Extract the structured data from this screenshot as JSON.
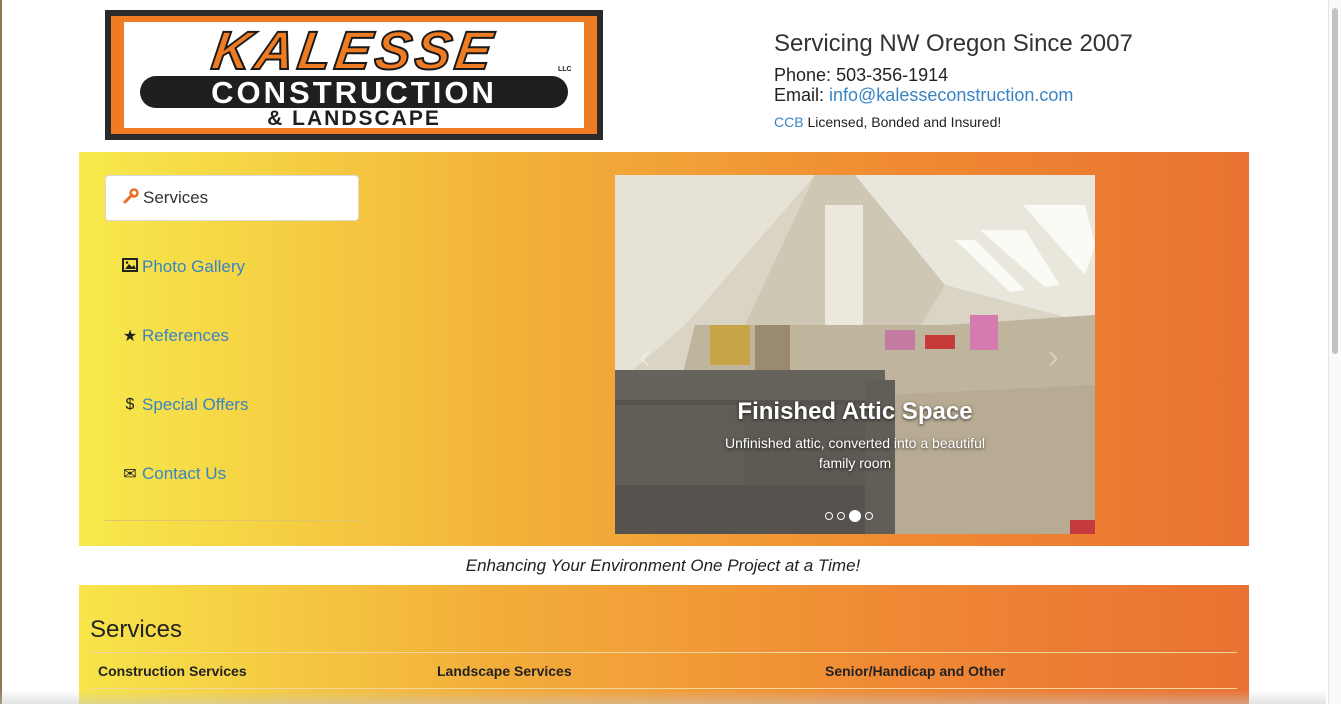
{
  "logo": {
    "brand": "KALESSE",
    "llc": "LLC",
    "line2": "CONSTRUCTION",
    "line3": "& LANDSCAPE"
  },
  "header": {
    "tagline": "Servicing NW Oregon Since 2007",
    "phone_label": "Phone: ",
    "phone": "503-356-1914",
    "email_label": "Email: ",
    "email": "info@kalesseconstruction.com",
    "ccb_link": "CCB",
    "ccb_text": " Licensed, Bonded and Insured!"
  },
  "nav": {
    "items": [
      {
        "label": "Services",
        "icon": "wrench-icon",
        "glyph": "🔧"
      },
      {
        "label": "Photo Gallery",
        "icon": "picture-icon",
        "glyph": "▣"
      },
      {
        "label": "References",
        "icon": "star-icon",
        "glyph": "★"
      },
      {
        "label": "Special Offers",
        "icon": "dollar-icon",
        "glyph": "$"
      },
      {
        "label": "Contact Us",
        "icon": "envelope-icon",
        "glyph": "✉"
      }
    ]
  },
  "carousel": {
    "caption_title": "Finished Attic Space",
    "caption_text": "Unfinished attic, converted into a beautiful family room",
    "prev_glyph": "‹",
    "next_glyph": "›",
    "slide_count": 4,
    "active_index": 2
  },
  "motto": "Enhancing Your Environment One Project at a Time!",
  "services": {
    "heading": "Services",
    "columns": [
      "Construction Services",
      "Landscape Services",
      "Senior/Handicap and Other"
    ]
  },
  "colors": {
    "accent_orange": "#ef7b22",
    "link_blue": "#3a84c4"
  }
}
